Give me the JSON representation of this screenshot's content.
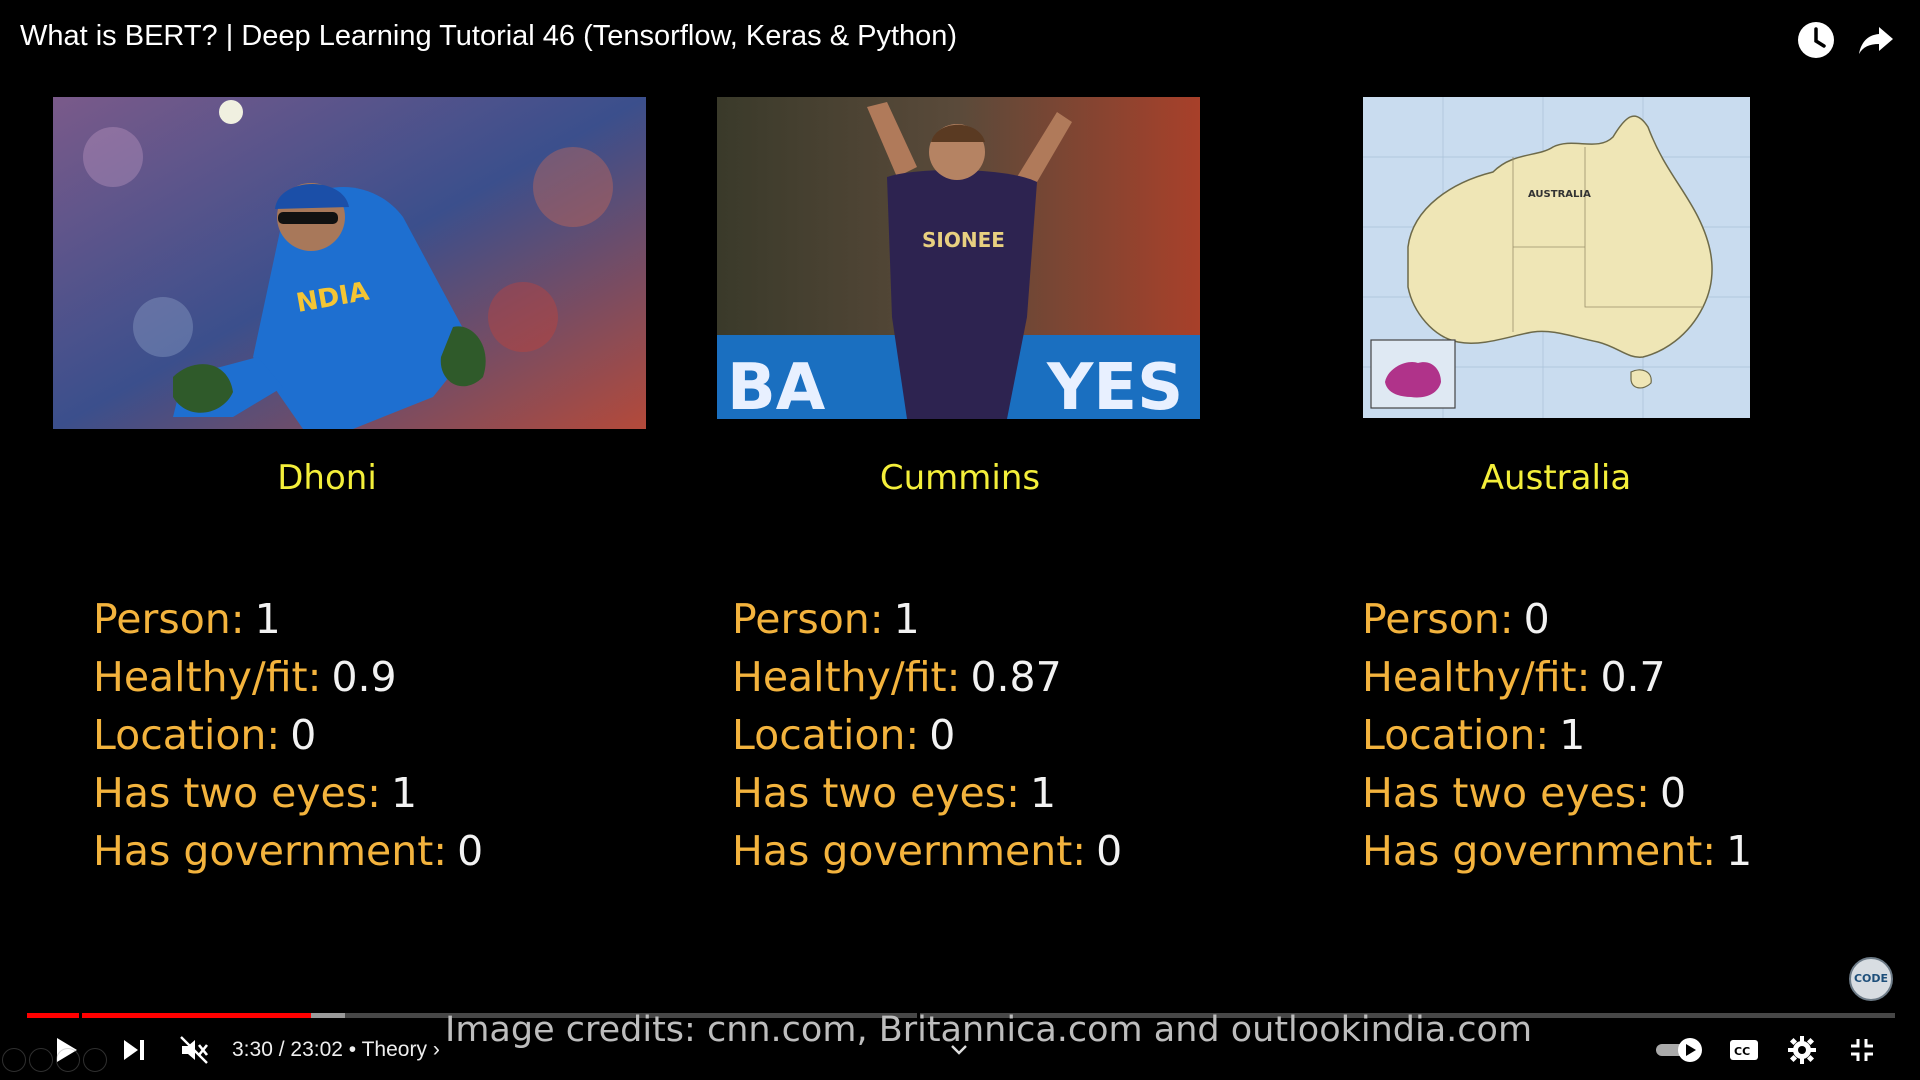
{
  "header": {
    "title": "What is BERT? | Deep Learning Tutorial 46 (Tensorflow, Keras & Python)",
    "icons": [
      "watch-later-icon",
      "share-icon"
    ]
  },
  "slide": {
    "items": [
      {
        "caption": "Dhoni",
        "image": "cricketer-photo",
        "features": [
          {
            "label": "Person:",
            "value": "1"
          },
          {
            "label": "Healthy/fit:",
            "value": "0.9"
          },
          {
            "label": "Location:",
            "value": "0"
          },
          {
            "label": "Has two eyes:",
            "value": "1"
          },
          {
            "label": "Has government:",
            "value": "0"
          }
        ]
      },
      {
        "caption": "Cummins",
        "image": "bowler-photo",
        "features": [
          {
            "label": "Person:",
            "value": "1"
          },
          {
            "label": "Healthy/fit:",
            "value": "0.87"
          },
          {
            "label": "Location:",
            "value": "0"
          },
          {
            "label": "Has two eyes:",
            "value": "1"
          },
          {
            "label": "Has government:",
            "value": "0"
          }
        ]
      },
      {
        "caption": "Australia",
        "image": "australia-map",
        "features": [
          {
            "label": "Person:",
            "value": "0"
          },
          {
            "label": "Healthy/fit:",
            "value": "0.7"
          },
          {
            "label": "Location:",
            "value": "1"
          },
          {
            "label": "Has two eyes:",
            "value": "0"
          },
          {
            "label": "Has government:",
            "value": "1"
          }
        ]
      }
    ],
    "credits": "Image credits: cnn.com, Britannica.com and outlookindia.com"
  },
  "player": {
    "current_time": "3:30",
    "duration": "23:02",
    "time_separator": " / ",
    "chapter_separator": " • ",
    "chapter": "Theory",
    "chapter_arrow": "›",
    "progress_fraction": 0.152,
    "buffered_fraction": 0.17,
    "accent_color": "#ff0000",
    "icons": [
      "play-icon",
      "next-icon",
      "muted-icon",
      "autoplay-toggle-icon",
      "cc-icon",
      "settings-icon",
      "exit-fullscreen-icon",
      "chevron-down-icon"
    ]
  },
  "colors": {
    "caption": "#f4ef3a",
    "feature_label": "#f3b33d",
    "feature_value": "#f2f2f2",
    "background": "#000000"
  }
}
